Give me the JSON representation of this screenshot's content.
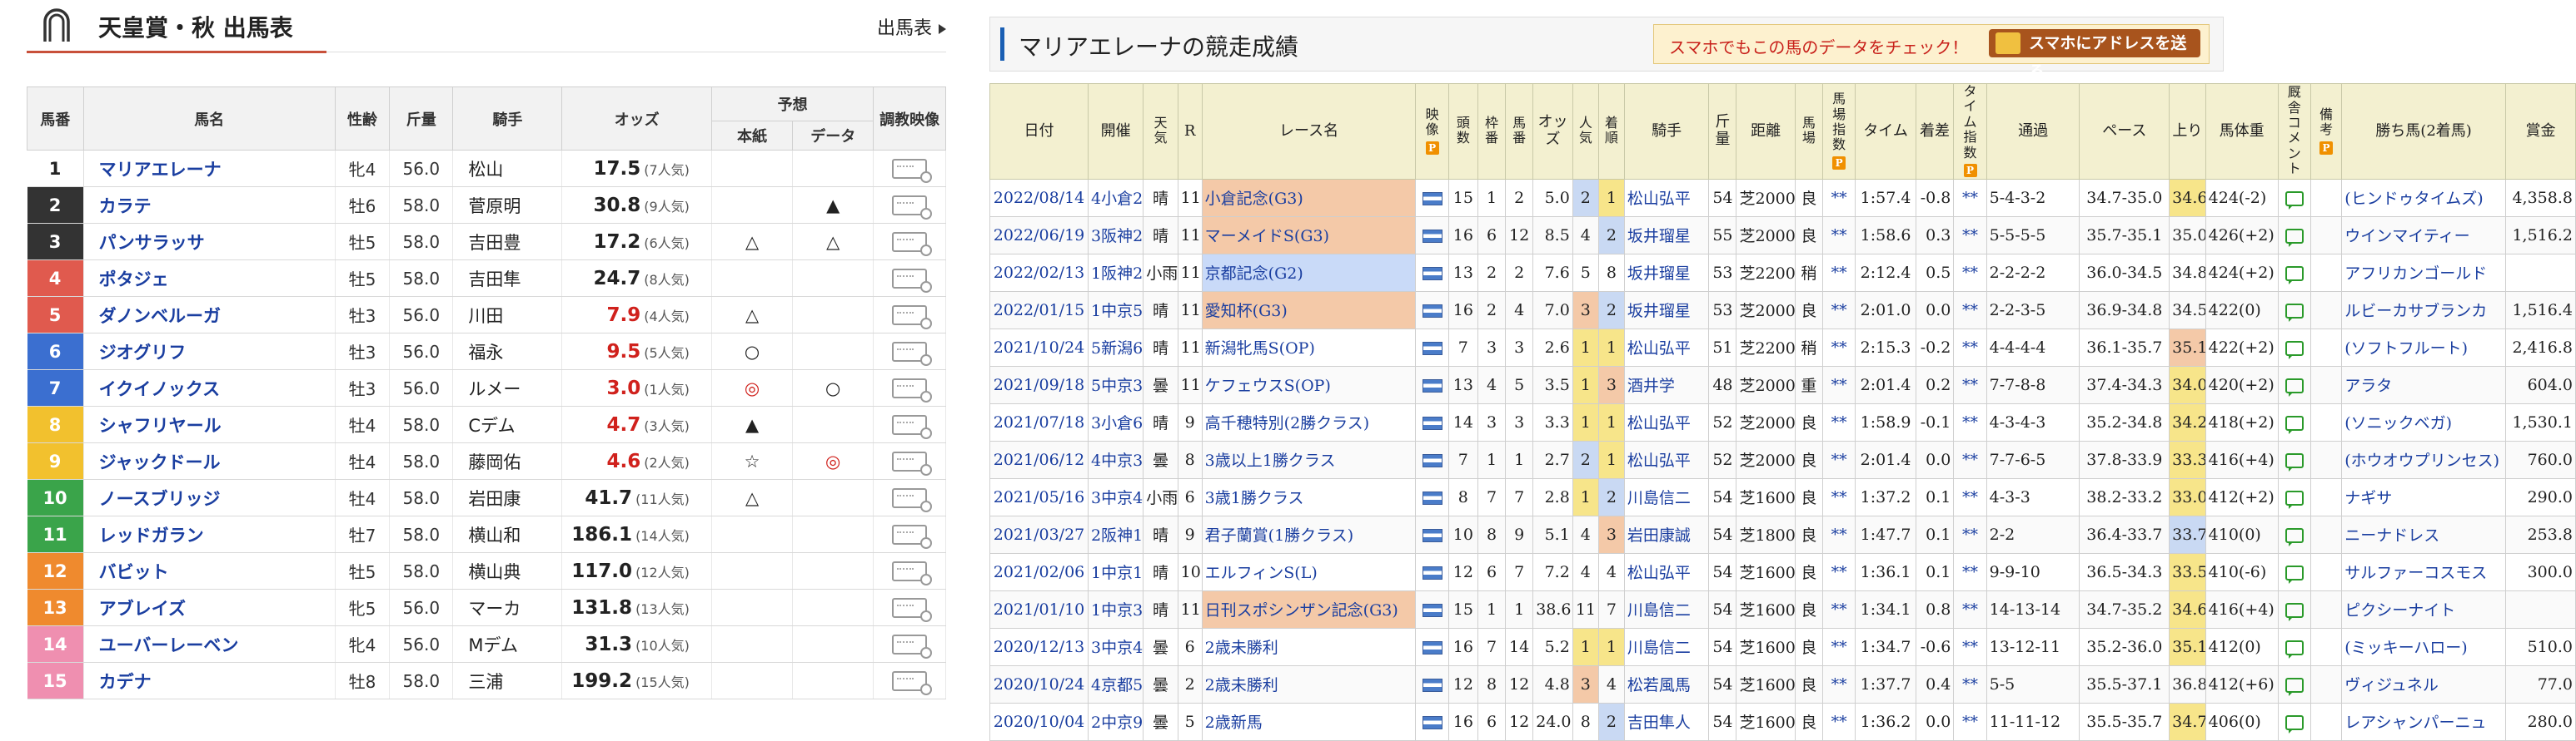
{
  "left": {
    "title": "天皇賞・秋 出馬表",
    "more_link": "出馬表",
    "headers": {
      "umaban": "馬番",
      "name": "馬名",
      "sexage": "性齢",
      "kinryo": "斤量",
      "jockey": "騎手",
      "odds": "オッズ",
      "yoso": "予想",
      "honshi": "本紙",
      "data": "データ",
      "video": "調教映像"
    },
    "rows": [
      {
        "no": "1",
        "name": "マリアエレーナ",
        "sexage": "牝4",
        "kinryo": "56.0",
        "jockey": "松山",
        "odds": "17.5",
        "pop": "(7人気)",
        "honshi": "",
        "data": "",
        "color": "#ffffff",
        "text": "#222222",
        "red": false
      },
      {
        "no": "2",
        "name": "カラテ",
        "sexage": "牡6",
        "kinryo": "58.0",
        "jockey": "菅原明",
        "odds": "30.8",
        "pop": "(9人気)",
        "honshi": "",
        "data": "▲",
        "color": "#333333",
        "text": "#ffffff",
        "red": false
      },
      {
        "no": "3",
        "name": "パンサラッサ",
        "sexage": "牡5",
        "kinryo": "58.0",
        "jockey": "吉田豊",
        "odds": "17.2",
        "pop": "(6人気)",
        "honshi": "△",
        "data": "△",
        "color": "#333333",
        "text": "#ffffff",
        "red": false
      },
      {
        "no": "4",
        "name": "ポタジェ",
        "sexage": "牡5",
        "kinryo": "58.0",
        "jockey": "吉田隼",
        "odds": "24.7",
        "pop": "(8人気)",
        "honshi": "",
        "data": "",
        "color": "#e05a4e",
        "text": "#ffffff",
        "red": false
      },
      {
        "no": "5",
        "name": "ダノンベルーガ",
        "sexage": "牡3",
        "kinryo": "56.0",
        "jockey": "川田",
        "odds": "7.9",
        "pop": "(4人気)",
        "honshi": "△",
        "data": "",
        "color": "#e05a4e",
        "text": "#ffffff",
        "red": true
      },
      {
        "no": "6",
        "name": "ジオグリフ",
        "sexage": "牡3",
        "kinryo": "56.0",
        "jockey": "福永",
        "odds": "9.5",
        "pop": "(5人気)",
        "honshi": "○",
        "data": "",
        "color": "#3b6fd0",
        "text": "#ffffff",
        "red": true
      },
      {
        "no": "7",
        "name": "イクイノックス",
        "sexage": "牡3",
        "kinryo": "56.0",
        "jockey": "ルメー",
        "odds": "3.0",
        "pop": "(1人気)",
        "honshi": "◎",
        "data": "○",
        "color": "#3b6fd0",
        "text": "#ffffff",
        "red": true
      },
      {
        "no": "8",
        "name": "シャフリヤール",
        "sexage": "牡4",
        "kinryo": "58.0",
        "jockey": "Cデム",
        "odds": "4.7",
        "pop": "(3人気)",
        "honshi": "▲",
        "data": "",
        "color": "#f2c12e",
        "text": "#ffffff",
        "red": true
      },
      {
        "no": "9",
        "name": "ジャックドール",
        "sexage": "牡4",
        "kinryo": "58.0",
        "jockey": "藤岡佑",
        "odds": "4.6",
        "pop": "(2人気)",
        "honshi": "☆",
        "data": "◎",
        "color": "#f2c12e",
        "text": "#ffffff",
        "red": true
      },
      {
        "no": "10",
        "name": "ノースブリッジ",
        "sexage": "牡4",
        "kinryo": "58.0",
        "jockey": "岩田康",
        "odds": "41.7",
        "pop": "(11人気)",
        "honshi": "△",
        "data": "",
        "color": "#3aa44a",
        "text": "#ffffff",
        "red": false
      },
      {
        "no": "11",
        "name": "レッドガラン",
        "sexage": "牡7",
        "kinryo": "58.0",
        "jockey": "横山和",
        "odds": "186.1",
        "pop": "(14人気)",
        "honshi": "",
        "data": "",
        "color": "#3aa44a",
        "text": "#ffffff",
        "red": false
      },
      {
        "no": "12",
        "name": "バビット",
        "sexage": "牡5",
        "kinryo": "58.0",
        "jockey": "横山典",
        "odds": "117.0",
        "pop": "(12人気)",
        "honshi": "",
        "data": "",
        "color": "#ef8a2e",
        "text": "#ffffff",
        "red": false
      },
      {
        "no": "13",
        "name": "アブレイズ",
        "sexage": "牝5",
        "kinryo": "56.0",
        "jockey": "マーカ",
        "odds": "131.8",
        "pop": "(13人気)",
        "honshi": "",
        "data": "",
        "color": "#ef8a2e",
        "text": "#ffffff",
        "red": false
      },
      {
        "no": "14",
        "name": "ユーバーレーベン",
        "sexage": "牝4",
        "kinryo": "56.0",
        "jockey": "Mデム",
        "odds": "31.3",
        "pop": "(10人気)",
        "honshi": "",
        "data": "",
        "color": "#ef8fb0",
        "text": "#ffffff",
        "red": false
      },
      {
        "no": "15",
        "name": "カデナ",
        "sexage": "牡8",
        "kinryo": "58.0",
        "jockey": "三浦",
        "odds": "199.2",
        "pop": "(15人気)",
        "honshi": "",
        "data": "",
        "color": "#ef8fb0",
        "text": "#ffffff",
        "red": false
      }
    ]
  },
  "right": {
    "title": "マリアエレーナの競走成績",
    "promo_text": "スマホでもこの馬のデータをチェック！",
    "promo_button": "スマホにアドレスを送る",
    "headers": [
      "日付",
      "開催",
      "天気",
      "R",
      "レース名",
      "映像",
      "頭数",
      "枠番",
      "馬番",
      "オッズ",
      "人気",
      "着順",
      "騎手",
      "斤量",
      "距離",
      "馬場",
      "馬場指数",
      "タイム",
      "着差",
      "タイム指数",
      "通過",
      "ペース",
      "上り",
      "馬体重",
      "厩舎コメント",
      "備考",
      "勝ち馬(2着馬)",
      "賞金"
    ],
    "rows": [
      {
        "date": "2022/08/14",
        "kaisai": "4小倉2",
        "tenki": "晴",
        "r": "11",
        "race": "小倉記念(G3)",
        "grade": "g1",
        "tosu": "15",
        "waku": "1",
        "uma": "2",
        "odds": "5.0",
        "pop": "2",
        "chaku": "1",
        "jockey": "松山弘平",
        "kin": "54",
        "dist": "芝2000",
        "baba": "良",
        "bidx": "**",
        "time": "1:57.4",
        "chakusa": "-0.8",
        "tidx": "**",
        "tsuka": "5-4-3-2",
        "pace": "34.7-35.0",
        "agari": "34.6",
        "ag": "1",
        "weight": "424(-2)",
        "winner": "(ヒンドゥタイムズ)",
        "prize": "4,358.8"
      },
      {
        "date": "2022/06/19",
        "kaisai": "3阪神2",
        "tenki": "晴",
        "r": "11",
        "race": "マーメイドS(G3)",
        "grade": "g1",
        "tosu": "16",
        "waku": "6",
        "uma": "12",
        "odds": "8.5",
        "pop": "4",
        "chaku": "2",
        "jockey": "坂井瑠星",
        "kin": "55",
        "dist": "芝2000",
        "baba": "良",
        "bidx": "**",
        "time": "1:58.6",
        "chakusa": "0.3",
        "tidx": "**",
        "tsuka": "5-5-5-5",
        "pace": "35.7-35.1",
        "agari": "35.0",
        "ag": "0",
        "weight": "426(+2)",
        "winner": "ウインマイティー",
        "prize": "1,516.2"
      },
      {
        "date": "2022/02/13",
        "kaisai": "1阪神2",
        "tenki": "小雨",
        "r": "11",
        "race": "京都記念(G2)",
        "grade": "g2",
        "tosu": "13",
        "waku": "2",
        "uma": "2",
        "odds": "7.6",
        "pop": "5",
        "chaku": "8",
        "jockey": "坂井瑠星",
        "kin": "53",
        "dist": "芝2200",
        "baba": "稍",
        "bidx": "**",
        "time": "2:12.4",
        "chakusa": "0.5",
        "tidx": "**",
        "tsuka": "2-2-2-2",
        "pace": "36.0-34.5",
        "agari": "34.8",
        "ag": "0",
        "weight": "424(+2)",
        "winner": "アフリカンゴールド",
        "prize": ""
      },
      {
        "date": "2022/01/15",
        "kaisai": "1中京5",
        "tenki": "晴",
        "r": "11",
        "race": "愛知杯(G3)",
        "grade": "g1",
        "tosu": "16",
        "waku": "2",
        "uma": "4",
        "odds": "7.0",
        "pop": "3",
        "chaku": "2",
        "jockey": "坂井瑠星",
        "kin": "53",
        "dist": "芝2000",
        "baba": "良",
        "bidx": "**",
        "time": "2:01.0",
        "chakusa": "0.0",
        "tidx": "**",
        "tsuka": "2-2-3-5",
        "pace": "36.9-34.8",
        "agari": "34.5",
        "ag": "0",
        "weight": "422(0)",
        "winner": "ルビーカサブランカ",
        "prize": "1,516.4"
      },
      {
        "date": "2021/10/24",
        "kaisai": "5新潟6",
        "tenki": "晴",
        "r": "11",
        "race": "新潟牝馬S(OP)",
        "grade": "",
        "tosu": "7",
        "waku": "3",
        "uma": "3",
        "odds": "2.6",
        "pop": "1",
        "chaku": "1",
        "jockey": "松山弘平",
        "kin": "51",
        "dist": "芝2200",
        "baba": "稍",
        "bidx": "**",
        "time": "2:15.3",
        "chakusa": "-0.2",
        "tidx": "**",
        "tsuka": "4-4-4-4",
        "pace": "36.1-35.7",
        "agari": "35.1",
        "ag": "3",
        "weight": "422(+2)",
        "winner": "(ソフトフルート)",
        "prize": "2,416.8"
      },
      {
        "date": "2021/09/18",
        "kaisai": "5中京3",
        "tenki": "曇",
        "r": "11",
        "race": "ケフェウスS(OP)",
        "grade": "",
        "tosu": "13",
        "waku": "4",
        "uma": "5",
        "odds": "3.5",
        "pop": "1",
        "chaku": "3",
        "jockey": "酒井学",
        "kin": "48",
        "dist": "芝2000",
        "baba": "重",
        "bidx": "**",
        "time": "2:01.4",
        "chakusa": "0.2",
        "tidx": "**",
        "tsuka": "7-7-8-8",
        "pace": "37.4-34.3",
        "agari": "34.0",
        "ag": "1",
        "weight": "420(+2)",
        "winner": "アラタ",
        "prize": "604.0"
      },
      {
        "date": "2021/07/18",
        "kaisai": "3小倉6",
        "tenki": "晴",
        "r": "9",
        "race": "高千穂特別(2勝クラス)",
        "grade": "",
        "tosu": "14",
        "waku": "3",
        "uma": "3",
        "odds": "3.3",
        "pop": "1",
        "chaku": "1",
        "jockey": "松山弘平",
        "kin": "52",
        "dist": "芝2000",
        "baba": "良",
        "bidx": "**",
        "time": "1:58.9",
        "chakusa": "-0.1",
        "tidx": "**",
        "tsuka": "4-3-4-3",
        "pace": "35.2-34.8",
        "agari": "34.2",
        "ag": "1",
        "weight": "418(+2)",
        "winner": "(ソニックベガ)",
        "prize": "1,530.1"
      },
      {
        "date": "2021/06/12",
        "kaisai": "4中京3",
        "tenki": "曇",
        "r": "8",
        "race": "3歳以上1勝クラス",
        "grade": "",
        "tosu": "7",
        "waku": "1",
        "uma": "1",
        "odds": "2.7",
        "pop": "2",
        "chaku": "1",
        "jockey": "松山弘平",
        "kin": "52",
        "dist": "芝2000",
        "baba": "良",
        "bidx": "**",
        "time": "2:01.4",
        "chakusa": "0.0",
        "tidx": "**",
        "tsuka": "7-7-6-5",
        "pace": "37.8-33.9",
        "agari": "33.3",
        "ag": "1",
        "weight": "416(+4)",
        "winner": "(ホウオウプリンセス)",
        "prize": "760.0"
      },
      {
        "date": "2021/05/16",
        "kaisai": "3中京4",
        "tenki": "小雨",
        "r": "6",
        "race": "3歳1勝クラス",
        "grade": "",
        "tosu": "8",
        "waku": "7",
        "uma": "7",
        "odds": "2.8",
        "pop": "1",
        "chaku": "2",
        "jockey": "川島信二",
        "kin": "54",
        "dist": "芝1600",
        "baba": "良",
        "bidx": "**",
        "time": "1:37.2",
        "chakusa": "0.1",
        "tidx": "**",
        "tsuka": "4-3-3",
        "pace": "38.2-33.2",
        "agari": "33.0",
        "ag": "1",
        "weight": "412(+2)",
        "winner": "ナギサ",
        "prize": "290.0"
      },
      {
        "date": "2021/03/27",
        "kaisai": "2阪神1",
        "tenki": "晴",
        "r": "9",
        "race": "君子蘭賞(1勝クラス)",
        "grade": "",
        "tosu": "10",
        "waku": "8",
        "uma": "9",
        "odds": "5.1",
        "pop": "4",
        "chaku": "3",
        "jockey": "岩田康誠",
        "kin": "54",
        "dist": "芝1800",
        "baba": "良",
        "bidx": "**",
        "time": "1:47.7",
        "chakusa": "0.1",
        "tidx": "**",
        "tsuka": "2-2",
        "pace": "36.4-33.7",
        "agari": "33.7",
        "ag": "2",
        "weight": "410(0)",
        "winner": "ニーナドレス",
        "prize": "253.8"
      },
      {
        "date": "2021/02/06",
        "kaisai": "1中京11",
        "tenki": "晴",
        "r": "10",
        "race": "エルフィンS(L)",
        "grade": "",
        "tosu": "12",
        "waku": "6",
        "uma": "7",
        "odds": "7.2",
        "pop": "4",
        "chaku": "4",
        "jockey": "松山弘平",
        "kin": "54",
        "dist": "芝1600",
        "baba": "良",
        "bidx": "**",
        "time": "1:36.1",
        "chakusa": "0.1",
        "tidx": "**",
        "tsuka": "9-9-10",
        "pace": "36.5-34.3",
        "agari": "33.5",
        "ag": "1",
        "weight": "410(-6)",
        "winner": "サルファーコスモス",
        "prize": "300.0"
      },
      {
        "date": "2021/01/10",
        "kaisai": "1中京3",
        "tenki": "晴",
        "r": "11",
        "race": "日刊スポシンザン記念(G3)",
        "grade": "g1",
        "tosu": "15",
        "waku": "1",
        "uma": "1",
        "odds": "38.6",
        "pop": "11",
        "chaku": "7",
        "jockey": "川島信二",
        "kin": "54",
        "dist": "芝1600",
        "baba": "良",
        "bidx": "**",
        "time": "1:34.1",
        "chakusa": "0.8",
        "tidx": "**",
        "tsuka": "14-13-14",
        "pace": "34.7-35.2",
        "agari": "34.6",
        "ag": "1",
        "weight": "416(+4)",
        "winner": "ピクシーナイト",
        "prize": ""
      },
      {
        "date": "2020/12/13",
        "kaisai": "3中京4",
        "tenki": "曇",
        "r": "6",
        "race": "2歳未勝利",
        "grade": "",
        "tosu": "16",
        "waku": "7",
        "uma": "14",
        "odds": "5.2",
        "pop": "1",
        "chaku": "1",
        "jockey": "川島信二",
        "kin": "54",
        "dist": "芝1600",
        "baba": "良",
        "bidx": "**",
        "time": "1:34.7",
        "chakusa": "-0.6",
        "tidx": "**",
        "tsuka": "13-12-11",
        "pace": "35.2-36.0",
        "agari": "35.1",
        "ag": "1",
        "weight": "412(0)",
        "winner": "(ミッキーハロー)",
        "prize": "510.0"
      },
      {
        "date": "2020/10/24",
        "kaisai": "4京都5",
        "tenki": "曇",
        "r": "2",
        "race": "2歳未勝利",
        "grade": "",
        "tosu": "12",
        "waku": "8",
        "uma": "12",
        "odds": "4.8",
        "pop": "3",
        "chaku": "4",
        "jockey": "松若風馬",
        "kin": "54",
        "dist": "芝1600",
        "baba": "良",
        "bidx": "**",
        "time": "1:37.7",
        "chakusa": "0.4",
        "tidx": "**",
        "tsuka": "5-5",
        "pace": "35.5-37.1",
        "agari": "36.8",
        "ag": "0",
        "weight": "412(+6)",
        "winner": "ヴィジュネル",
        "prize": "77.0"
      },
      {
        "date": "2020/10/04",
        "kaisai": "2中京9",
        "tenki": "曇",
        "r": "5",
        "race": "2歳新馬",
        "grade": "",
        "tosu": "16",
        "waku": "6",
        "uma": "12",
        "odds": "24.0",
        "pop": "8",
        "chaku": "2",
        "jockey": "吉田隼人",
        "kin": "54",
        "dist": "芝1600",
        "baba": "良",
        "bidx": "**",
        "time": "1:36.2",
        "chakusa": "0.0",
        "tidx": "**",
        "tsuka": "11-11-12",
        "pace": "35.5-35.7",
        "agari": "34.7",
        "ag": "1",
        "weight": "406(0)",
        "winner": "レアシャンパーニュ",
        "prize": "280.0"
      }
    ]
  }
}
